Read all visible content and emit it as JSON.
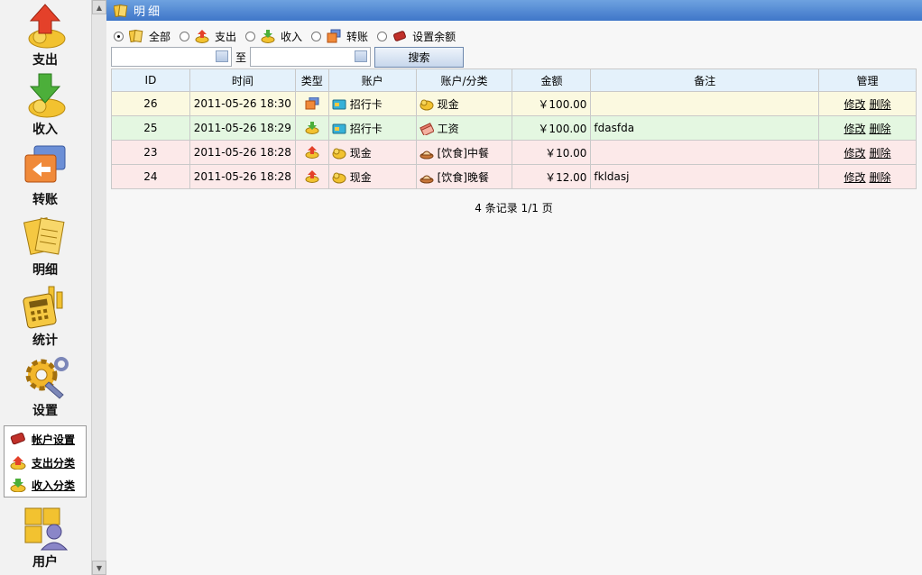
{
  "sidebar": {
    "items": [
      {
        "label": "支出",
        "icon": "expense-icon"
      },
      {
        "label": "收入",
        "icon": "income-icon"
      },
      {
        "label": "转账",
        "icon": "transfer-icon"
      },
      {
        "label": "明细",
        "icon": "details-icon"
      },
      {
        "label": "统计",
        "icon": "statistics-icon"
      },
      {
        "label": "设置",
        "icon": "settings-icon"
      }
    ],
    "sub_items": [
      {
        "label": "帐户设置",
        "icon": "account-settings-icon"
      },
      {
        "label": "支出分类",
        "icon": "expense-category-icon"
      },
      {
        "label": "收入分类",
        "icon": "income-category-icon"
      }
    ],
    "user": {
      "label": "用户",
      "icon": "user-icon"
    }
  },
  "header": {
    "title": "明细"
  },
  "filters": {
    "options": [
      {
        "label": "全部",
        "selected": true
      },
      {
        "label": "支出",
        "selected": false
      },
      {
        "label": "收入",
        "selected": false
      },
      {
        "label": "转账",
        "selected": false
      },
      {
        "label": "设置余额",
        "selected": false
      }
    ]
  },
  "search": {
    "from_value": "",
    "to_label": "至",
    "to_value": "",
    "button_label": "搜索"
  },
  "table": {
    "columns": [
      "ID",
      "时间",
      "类型",
      "账户",
      "账户/分类",
      "金额",
      "备注",
      "管理"
    ],
    "rows": [
      {
        "id": "26",
        "time": "2011-05-26 18:30",
        "type": "transfer",
        "account": "招行卡",
        "category": "现金",
        "amount": "￥100.00",
        "note": "",
        "edit": "修改",
        "delete": "删除"
      },
      {
        "id": "25",
        "time": "2011-05-26 18:29",
        "type": "income",
        "account": "招行卡",
        "category": "工资",
        "amount": "￥100.00",
        "note": "fdasfda",
        "edit": "修改",
        "delete": "删除"
      },
      {
        "id": "23",
        "time": "2011-05-26 18:28",
        "type": "expense",
        "account": "现金",
        "category": "[饮食]中餐",
        "amount": "￥10.00",
        "note": "",
        "edit": "修改",
        "delete": "删除"
      },
      {
        "id": "24",
        "time": "2011-05-26 18:28",
        "type": "expense",
        "account": "现金",
        "category": "[饮食]晚餐",
        "amount": "￥12.00",
        "note": "fkldasj",
        "edit": "修改",
        "delete": "删除"
      }
    ]
  },
  "pager": {
    "text": "4 条记录  1/1 页"
  }
}
